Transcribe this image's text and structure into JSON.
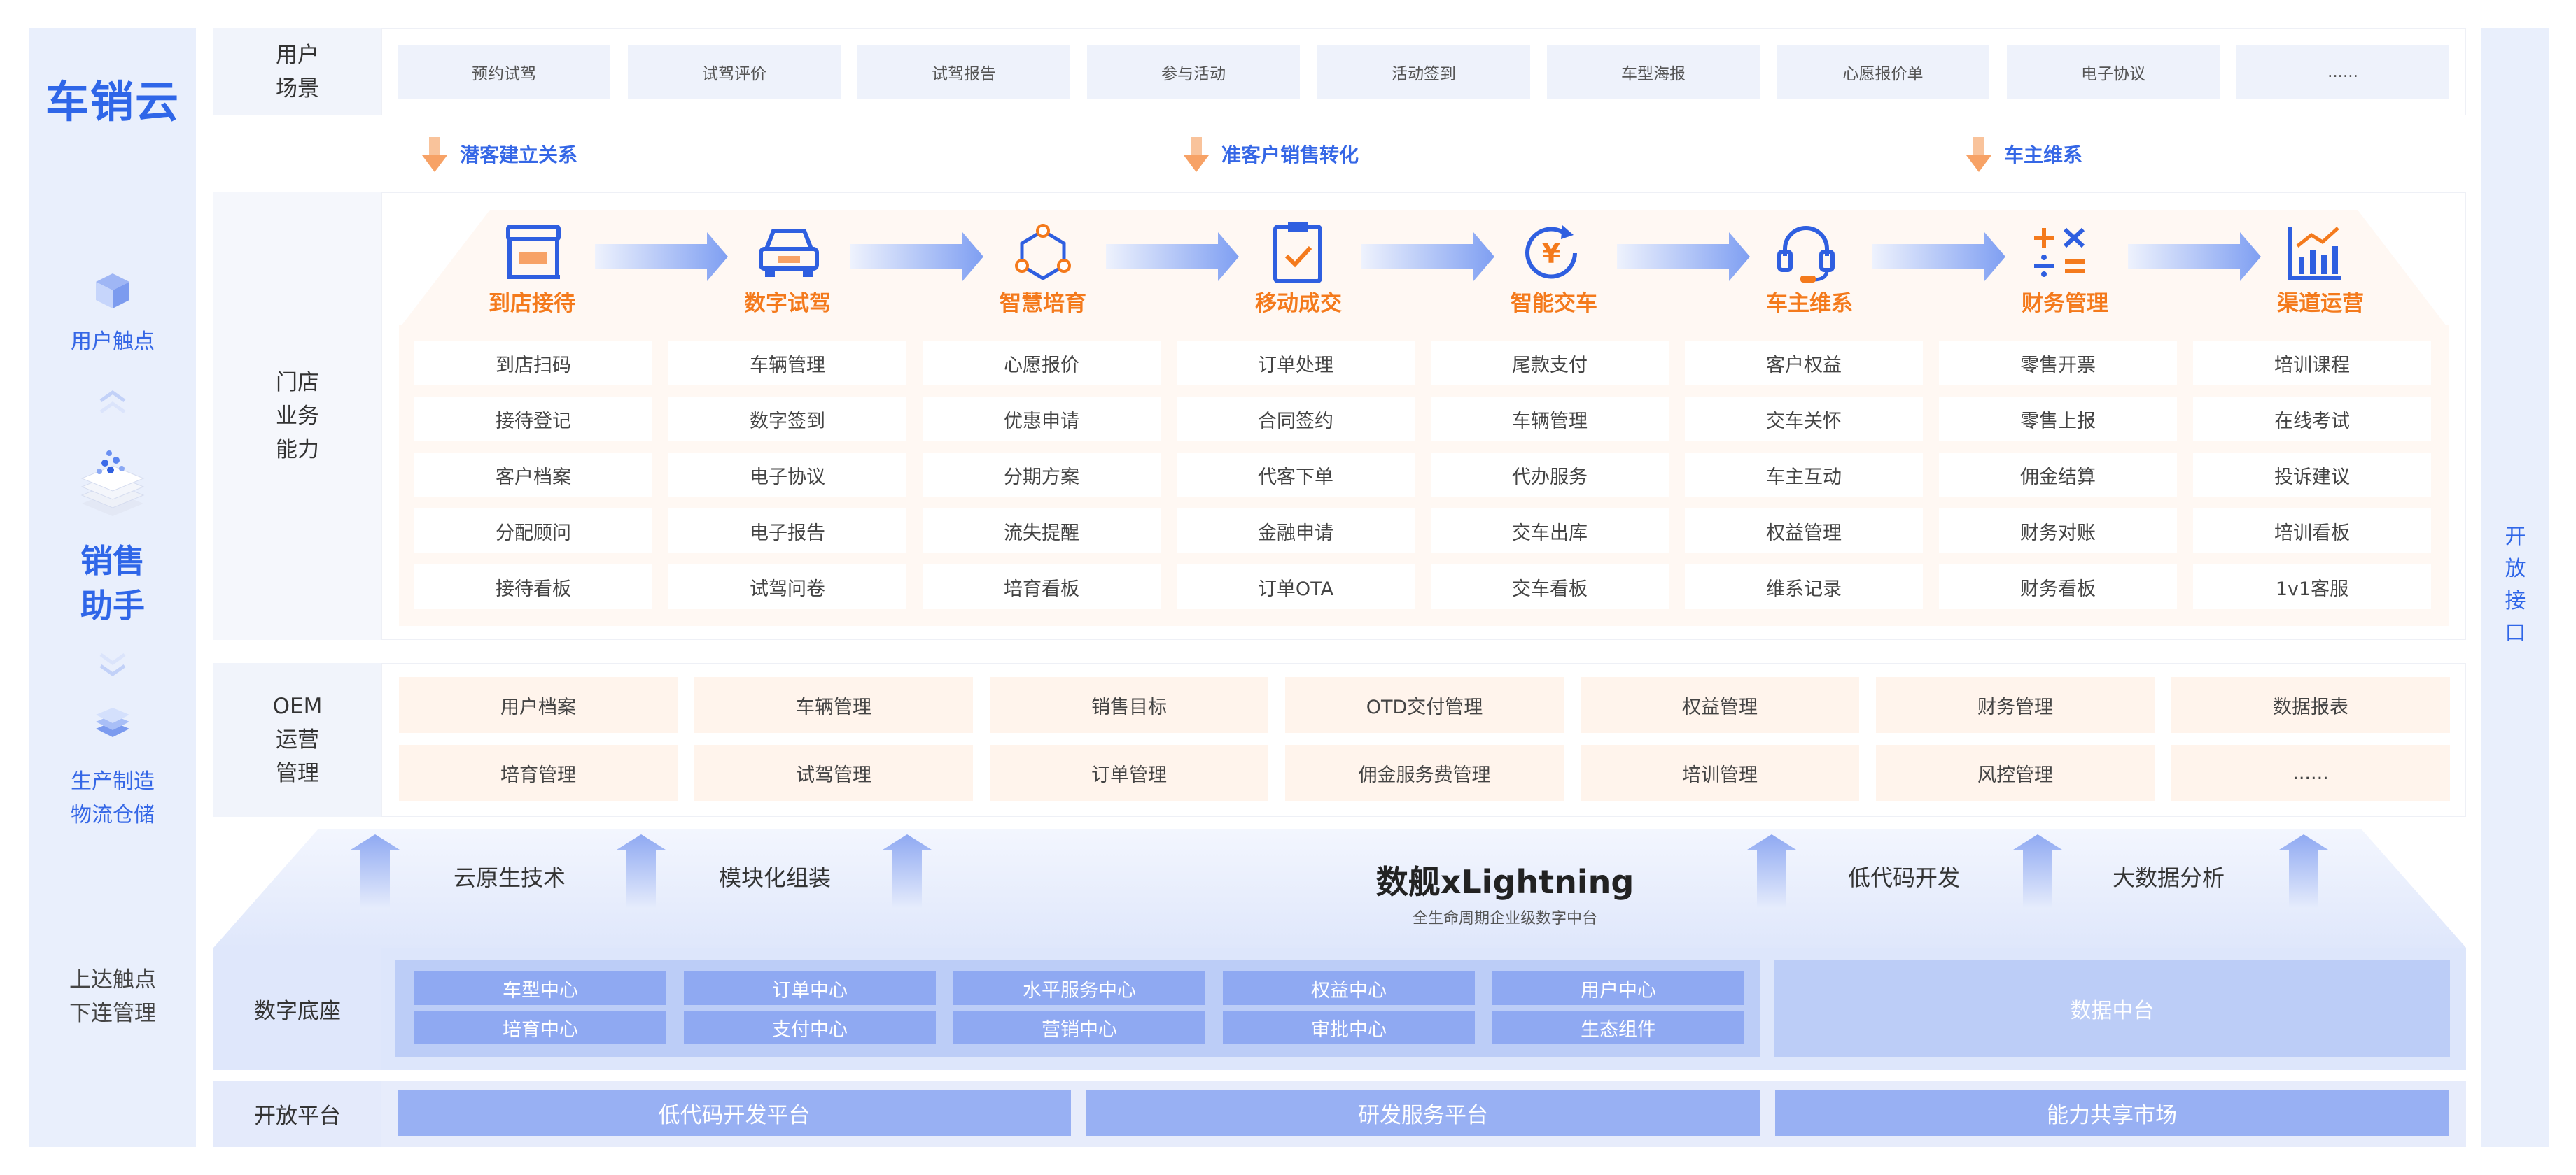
{
  "brand": "车销云",
  "left_rail": {
    "user_touch": "用户触点",
    "sales_assistant_1": "销售",
    "sales_assistant_2": "助手",
    "production_1": "生产制造",
    "production_2": "物流仓储",
    "bottom_1": "上达触点",
    "bottom_2": "下连管理"
  },
  "right_rail": {
    "chars": [
      "开",
      "放",
      "接",
      "口"
    ]
  },
  "rows": {
    "user_scene": [
      "用户",
      "场景"
    ],
    "store": [
      "门店",
      "业务",
      "能力"
    ],
    "oem": [
      "OEM",
      "运营",
      "管理"
    ],
    "digital_base": "数字底座",
    "open_platform": "开放平台"
  },
  "user_scenes": [
    "预约试驾",
    "试驾评价",
    "试驾报告",
    "参与活动",
    "活动签到",
    "车型海报",
    "心愿报价单",
    "电子协议",
    "......"
  ],
  "stages": [
    "潜客建立关系",
    "准客户销售转化",
    "车主维系"
  ],
  "store_columns": [
    {
      "title": "到店接待",
      "icon": "store-icon",
      "items": [
        "到店扫码",
        "接待登记",
        "客户档案",
        "分配顾问",
        "接待看板"
      ]
    },
    {
      "title": "数字试驾",
      "icon": "car-icon",
      "items": [
        "车辆管理",
        "数字签到",
        "电子协议",
        "电子报告",
        "试驾问卷"
      ]
    },
    {
      "title": "智慧培育",
      "icon": "network-icon",
      "items": [
        "心愿报价",
        "优惠申请",
        "分期方案",
        "流失提醒",
        "培育看板"
      ]
    },
    {
      "title": "移动成交",
      "icon": "clipboard-check-icon",
      "items": [
        "订单处理",
        "合同签约",
        "代客下单",
        "金融申请",
        "订单OTA"
      ]
    },
    {
      "title": "智能交车",
      "icon": "yen-refresh-icon",
      "items": [
        "尾款支付",
        "车辆管理",
        "代办服务",
        "交车出库",
        "交车看板"
      ]
    },
    {
      "title": "车主维系",
      "icon": "headset-icon",
      "items": [
        "客户权益",
        "交车关怀",
        "车主互动",
        "权益管理",
        "维系记录"
      ]
    },
    {
      "title": "财务管理",
      "icon": "calculator-icon",
      "items": [
        "零售开票",
        "零售上报",
        "佣金结算",
        "财务对账",
        "财务看板"
      ]
    },
    {
      "title": "渠道运营",
      "icon": "chart-icon",
      "items": [
        "培训课程",
        "在线考试",
        "投诉建议",
        "培训看板",
        "1v1客服"
      ]
    }
  ],
  "oem_items": [
    [
      "用户档案",
      "车辆管理",
      "销售目标",
      "OTD交付管理",
      "权益管理",
      "财务管理",
      "数据报表"
    ],
    [
      "培育管理",
      "试驾管理",
      "订单管理",
      "佣金服务费管理",
      "培训管理",
      "风控管理",
      "......"
    ]
  ],
  "platform": {
    "title": "数舰xLightning",
    "subtitle": "全生命周期企业级数字中台",
    "tech": [
      "云原生技术",
      "模块化组装",
      "低代码开发",
      "大数据分析"
    ]
  },
  "centers": [
    [
      "车型中心",
      "订单中心",
      "水平服务中心",
      "权益中心",
      "用户中心"
    ],
    [
      "培育中心",
      "支付中心",
      "营销中心",
      "审批中心",
      "生态组件"
    ]
  ],
  "data_center": "数据中台",
  "open_platforms": [
    "低代码开发平台",
    "研发服务平台",
    "能力共享市场"
  ],
  "colors": {
    "brand_blue": "#2f66e8",
    "accent_orange": "#f47a1c",
    "arrow_orange": "#f7a266"
  }
}
